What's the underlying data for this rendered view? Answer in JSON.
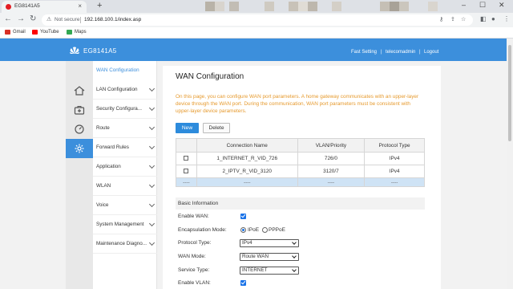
{
  "browser": {
    "tab_title": "EG8141A5",
    "tab_close": "×",
    "new_tab": "+",
    "security_label": "Not secure",
    "url": "192.168.100.1/index.asp",
    "icons": [
      "back-icon",
      "forward-icon",
      "reload-icon",
      "warning-icon",
      "key-icon",
      "share-icon",
      "star-icon",
      "extension-icon",
      "puzzle-icon",
      "sidebar-icon",
      "profile-icon",
      "menu-icon"
    ],
    "window_controls": {
      "minimize": "–",
      "maximize": "☐",
      "close": "✕"
    }
  },
  "bookmarks": [
    {
      "label": "Gmail",
      "color": "#d93025"
    },
    {
      "label": "YouTube",
      "color": "#ff0000"
    },
    {
      "label": "Maps",
      "color": "#34a853"
    }
  ],
  "header": {
    "brand": "EG8141A5",
    "links": [
      "Fast Setting",
      "telecomadmin",
      "Logout"
    ],
    "accent": "#3c8fdc"
  },
  "icon_sidebar": [
    "home-icon",
    "medkit-icon",
    "gauge-icon",
    "gear-icon"
  ],
  "menu": [
    {
      "label": "WAN Configuration",
      "active": true
    },
    {
      "label": "LAN Configuration"
    },
    {
      "label": "Security Configura..."
    },
    {
      "label": "Route"
    },
    {
      "label": "Forward Rules"
    },
    {
      "label": "Application"
    },
    {
      "label": "WLAN"
    },
    {
      "label": "Voice"
    },
    {
      "label": "System Management"
    },
    {
      "label": "Maintenance Diagno..."
    }
  ],
  "page": {
    "title": "WAN Configuration",
    "intro": "On this page, you can configure WAN port parameters. A home gateway communicates with an upper-layer device through the WAN port. During the communication, WAN port parameters must be consistent with upper-layer device parameters.",
    "new_label": "New",
    "delete_label": "Delete"
  },
  "wan_table": {
    "headers": [
      "",
      "Connection Name",
      "VLAN/Priority",
      "Protocol Type"
    ],
    "rows": [
      {
        "name": "1_INTERNET_R_VID_726",
        "vlan": "726/0",
        "protocol": "IPv4"
      },
      {
        "name": "2_IPTV_R_VID_3120",
        "vlan": "3120/7",
        "protocol": "IPv4"
      }
    ],
    "empty_row": [
      "----",
      "----",
      "----",
      "----"
    ]
  },
  "basic_info": {
    "section_title": "Basic Information",
    "enable_wan_label": "Enable WAN:",
    "encapsulation_label": "Encapsulation Mode:",
    "encap_options": [
      "IPoE",
      "PPPoE"
    ],
    "encap_selected": "IPoE",
    "protocol_type_label": "Protocol Type:",
    "protocol_type_value": "IPv4",
    "wan_mode_label": "WAN Mode:",
    "wan_mode_value": "Route WAN",
    "service_type_label": "Service Type:",
    "service_type_value": "INTERNET",
    "enable_vlan_label": "Enable VLAN:"
  }
}
